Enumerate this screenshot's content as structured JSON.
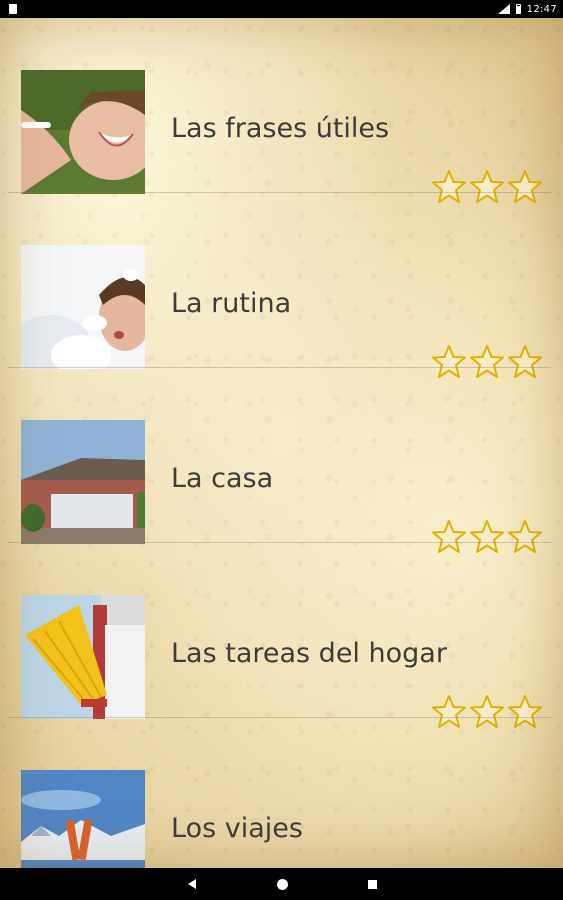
{
  "status_bar": {
    "time": "12:47",
    "icons": [
      "sim-card-icon",
      "signal-icon",
      "battery-icon"
    ]
  },
  "lessons": [
    {
      "title": "Las frases útiles",
      "image": "smiling-woman-on-grass",
      "stars_filled": 0,
      "stars_total": 3
    },
    {
      "title": "La rutina",
      "image": "woman-in-bubble-bath",
      "stars_filled": 0,
      "stars_total": 3
    },
    {
      "title": "La casa",
      "image": "house-with-garage",
      "stars_filled": 0,
      "stars_total": 3
    },
    {
      "title": "Las tareas del hogar",
      "image": "person-with-broom",
      "stars_filled": 0,
      "stars_total": 3
    },
    {
      "title": "Los viajes",
      "image": "skis-over-mountains",
      "stars_filled": 0,
      "stars_total": 3
    }
  ],
  "nav_bar": {
    "buttons": [
      "back-icon",
      "home-icon",
      "recents-icon"
    ]
  },
  "colors": {
    "parchment": "#efe0b8",
    "title_text": "#3c3c3c",
    "star_outline": "#e2b100"
  }
}
